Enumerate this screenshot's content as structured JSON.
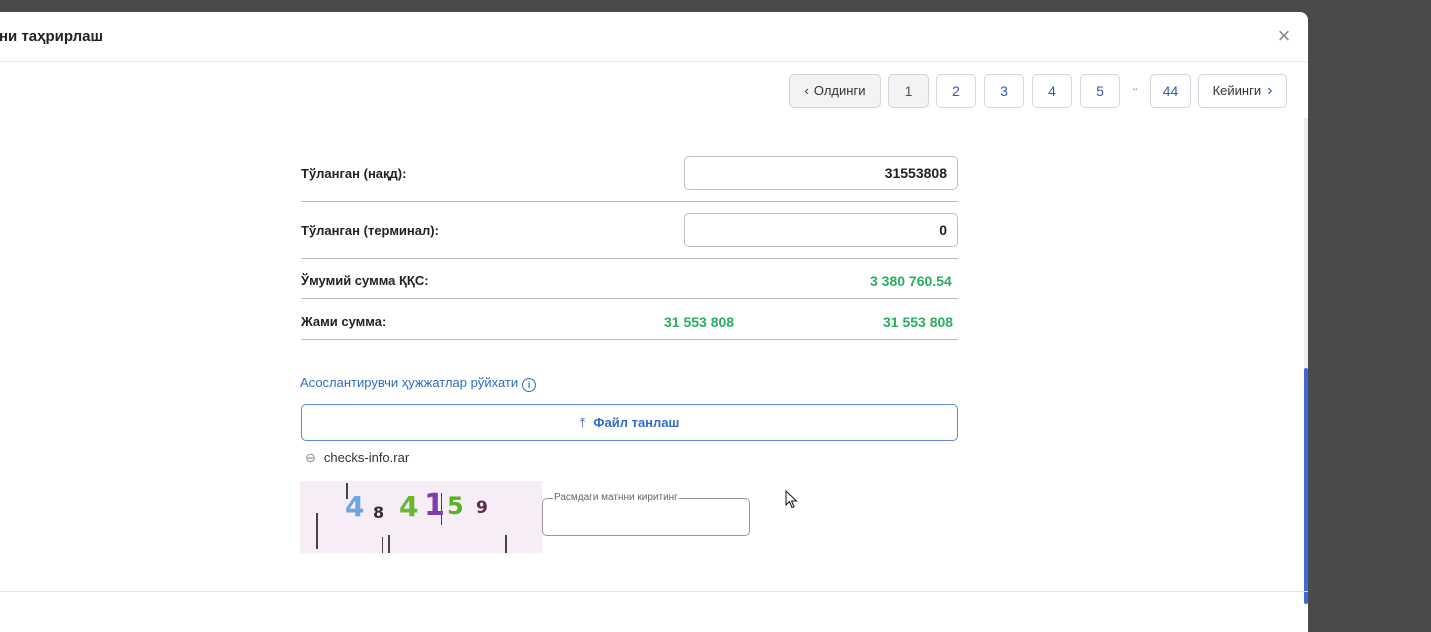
{
  "modal": {
    "title": "ни таҳрирлаш",
    "close_icon": "close-icon"
  },
  "pagination": {
    "prev_label": "Олдинги",
    "next_label": "Кейинги",
    "pages": [
      "1",
      "2",
      "3",
      "4",
      "5"
    ],
    "ellipsis": "··",
    "last_page": "44",
    "active_page": "1"
  },
  "form": {
    "paid_cash_label": "Тўланган (нақд):",
    "paid_cash_value": "31553808",
    "paid_terminal_label": "Тўланган (терминал):",
    "paid_terminal_value": "0",
    "vat_total_label": "Ўмумий сумма ҚҚС:",
    "vat_total_value": "3 380 760.54",
    "grand_total_label": "Жами сумма:",
    "grand_total_value_1": "31 553 808",
    "grand_total_value_2": "31 553 808"
  },
  "documents": {
    "link_label": "Асослантирувчи ҳужжатлар рўйхати",
    "info_icon": "i",
    "file_button_label": "Файл танлаш",
    "upload_icon": "⤒",
    "attachment_icon": "⊘",
    "attachment_name": "checks-info.rar"
  },
  "captcha": {
    "chars": [
      "4",
      "8",
      "4",
      "1",
      "5",
      "9"
    ],
    "input_placeholder": "Расмдаги матнни киритинг",
    "input_value": ""
  },
  "colors": {
    "accent": "#2f6cc4",
    "success": "#27ae60",
    "scrollbar": "#3d6ad6"
  }
}
